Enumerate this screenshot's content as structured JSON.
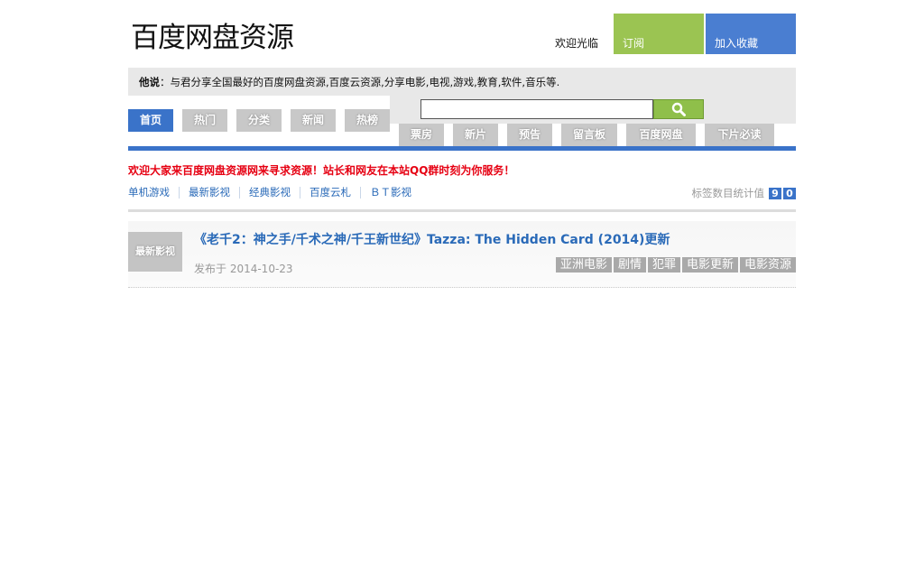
{
  "site": {
    "logo_text": "百度网盘资源",
    "welcome": "欢迎光临",
    "subscribe_label": "订阅",
    "favorite_label": "加入收藏"
  },
  "intro": {
    "speaker": "他说",
    "text": "：与君分享全国最好的百度网盘资源,百度云资源,分享电影,电视,游戏,教育,软件,音乐等."
  },
  "nav_primary": [
    "首页",
    "热门",
    "分类",
    "新闻",
    "热榜"
  ],
  "nav_secondary": [
    "票房",
    "新片",
    "预告",
    "留言板",
    "百度网盘",
    "下片必读"
  ],
  "search": {
    "placeholder": "",
    "button_icon": "search-icon"
  },
  "notice": "欢迎大家来百度网盘资源网来寻求资源！站长和网友在本站QQ群时刻为你服务！",
  "quick_links": [
    "单机游戏",
    "最新影视",
    "经典影视",
    "百度云札",
    "ＢＴ影视"
  ],
  "tag_stats": {
    "label": "标签数目统计值",
    "digits": [
      "9",
      "0"
    ]
  },
  "post": {
    "category": "最新影视",
    "title": "《老千2：神之手/千术之神/千王新世纪》Tazza: The Hidden Card (2014)更新",
    "date": "发布于 2014-10-23",
    "tags": [
      "亚洲电影",
      "剧情",
      "犯罪",
      "电影更新",
      "电影资源"
    ]
  },
  "colors": {
    "accent_blue": "#3a73c9",
    "accent_green": "#9bc452",
    "notice_red": "#e60012"
  }
}
